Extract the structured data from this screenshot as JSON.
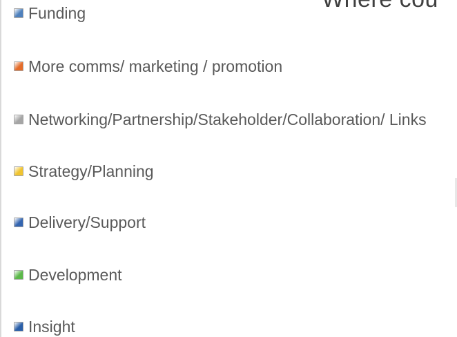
{
  "chart_data": {
    "type": "bar",
    "title": "Where cou",
    "legend": [
      {
        "name": "Funding",
        "color": "#4f81bd"
      },
      {
        "name": "More comms/ marketing / promotion",
        "color": "#e46c2a"
      },
      {
        "name": "Networking/Partnership/Stakeholder/Collaboration/ Links",
        "color": "#a5a5a5"
      },
      {
        "name": "Strategy/Planning",
        "color": "#f0c430"
      },
      {
        "name": "Delivery/Support",
        "color": "#3465b0"
      },
      {
        "name": "Development",
        "color": "#5cb84a"
      },
      {
        "name": "Insight",
        "color": "#2a5fa8"
      }
    ],
    "legend_position": "left"
  }
}
